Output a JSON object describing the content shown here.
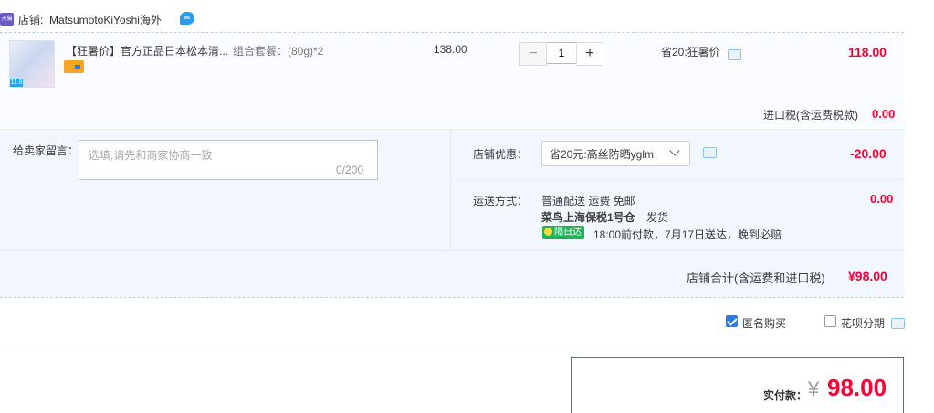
{
  "shop": {
    "badge": "天猫",
    "label": "店铺:",
    "name": "MatsumotoKiYoshi海外",
    "ww_icon": "ww-chat-icon"
  },
  "item": {
    "thumb_tag": "11.8",
    "title": "【狂暑价】官方正品日本松本清...",
    "sku": "组合套餐：(80g)*2",
    "unit_price": "138.00",
    "quantity": "1",
    "qty_minus": "−",
    "qty_plus": "+",
    "promo": "省20:狂暑价",
    "price": "118.00"
  },
  "tax": {
    "label": "进口税(含运费税款)",
    "value": "0.00"
  },
  "note": {
    "label": "给卖家留言：",
    "placeholder": "选填,请先和商家协商一致",
    "count": "0/200"
  },
  "discount": {
    "label": "店铺优惠：",
    "selected": "省20元:高丝防晒yglm",
    "value": "-20.00"
  },
  "shipping": {
    "label": "运送方式：",
    "method": "普通配送 运费 免邮",
    "value": "0.00",
    "warehouse": "菜鸟上海保税1号仓",
    "dispatch": "发货",
    "badge": "隔日达",
    "delivery_note": "18:00前付款，7月17日送达，晚到必赔"
  },
  "shop_total": {
    "label": "店铺合计(含运费和进口税)",
    "value": "¥98.00"
  },
  "options": {
    "anonymous_label": "匿名购买",
    "anonymous_checked": true,
    "huabei_label": "花呗分期",
    "huabei_checked": false
  },
  "payment": {
    "label": "实付款：",
    "currency": "¥",
    "value": "98.00"
  },
  "colors": {
    "price_red": "#ff0036",
    "light_blue_bg": "#f2f7ff",
    "accent_blue": "#2b7be3"
  }
}
